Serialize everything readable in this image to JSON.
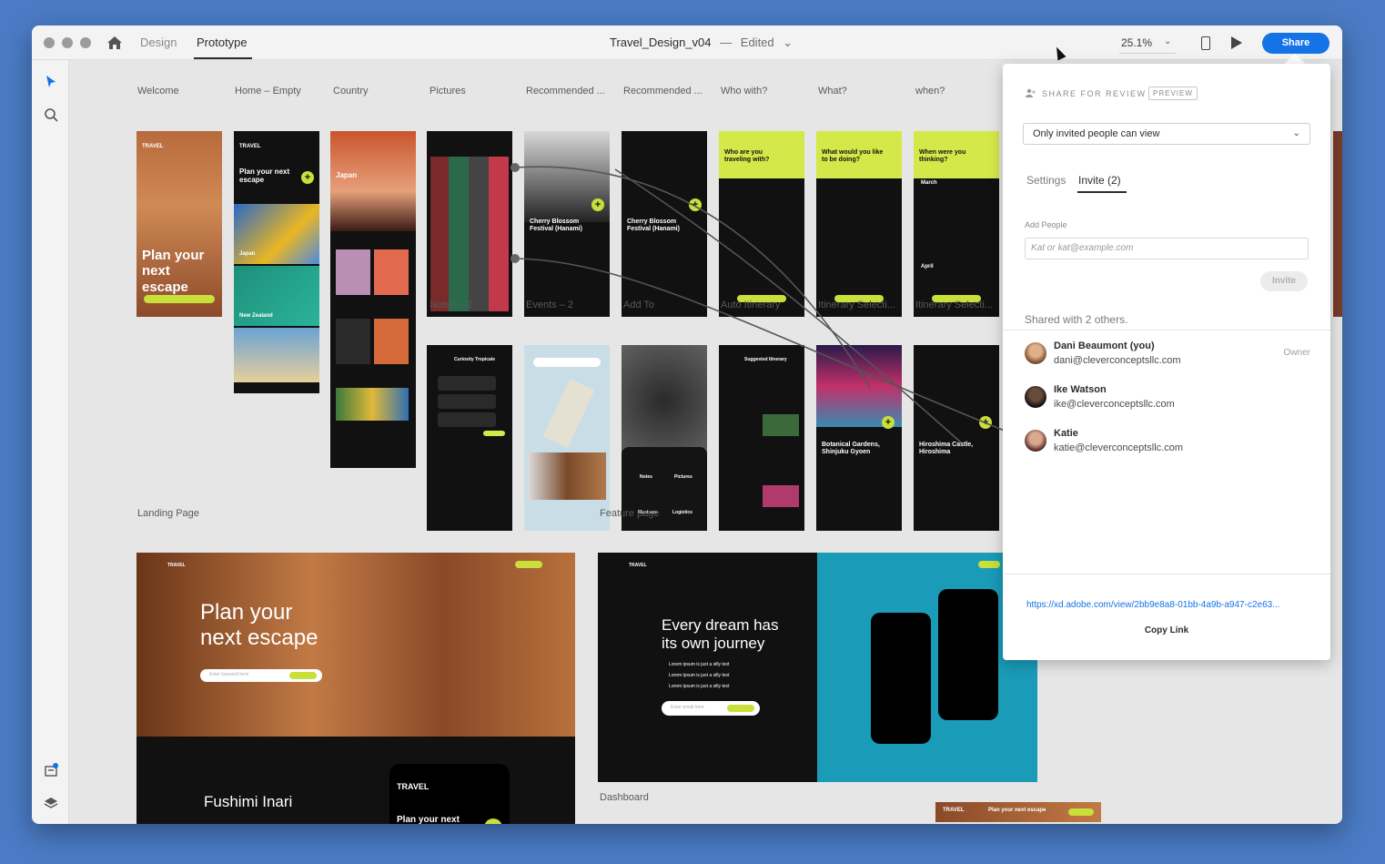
{
  "titlebar": {
    "mode_design": "Design",
    "mode_prototype": "Prototype",
    "document_name": "Travel_Design_v04",
    "separator": "—",
    "status": "Edited",
    "zoom": "25.1%",
    "share_label": "Share"
  },
  "artboards": {
    "row1": [
      "Welcome",
      "Home – Empty",
      "Country",
      "Pictures",
      "Recommended ...",
      "Recommended ...",
      "Who with?",
      "What?",
      "when?"
    ],
    "row2": [
      "Notes – 2",
      "Events – 2",
      "Add To",
      "Auto Itinerary",
      "Itinerary Selecti...",
      "Itinerary Selecti..."
    ],
    "landing": "Landing Page",
    "feature": "Feature page",
    "dashboard": "Dashboard"
  },
  "mockups": {
    "brand": "TRAVEL",
    "hero": "Plan your next escape",
    "home_title": "Plan your next escape",
    "country": "Japan",
    "japan_label": "Japan",
    "nz_label": "New Zealand",
    "events_title": "Cherry Blossom Festival (Hanami)",
    "who_title": "Who are you traveling with?",
    "what_title": "What would you like to be doing?",
    "when_title": "When were you thinking?",
    "when_month": "March",
    "when_month2": "April",
    "itin1": "Botanical Gardens, Shinjuku Gyoen",
    "itin2": "Hiroshima Castle, Hiroshima",
    "auto_title": "Suggested Itinerary",
    "notes_title": "Curiosity Tropicale",
    "add_notes": "Notes",
    "add_pictures": "Pictures",
    "add_mustsee": "Must see",
    "add_logistics": "Logistics",
    "landing_hero": "Plan your next escape",
    "landing_input": "Enter keyword here",
    "landing_section": "Fushimi Inari",
    "feature_hero": "Every dream has its own journey",
    "feature_bullets": [
      "Lorem ipsum is just a silly text",
      "Lorem ipsum is just a silly text",
      "Lorem ipsum is just a silly text"
    ],
    "feature_input": "Enter email here",
    "button": "Button"
  },
  "share_panel": {
    "heading": "SHARE FOR REVIEW",
    "badge": "PREVIEW",
    "access": "Only invited people can view",
    "tabs": [
      "Settings",
      "Invite (2)"
    ],
    "add_people_label": "Add People",
    "add_people_placeholder": "Kat or kat@example.com",
    "invite_label": "Invite",
    "shared_with": "Shared with 2 others.",
    "people": [
      {
        "name": "Dani Beaumont (you)",
        "email": "dani@cleverconceptsllc.com",
        "role": "Owner"
      },
      {
        "name": "Ike Watson",
        "email": "ike@cleverconceptsllc.com",
        "role": ""
      },
      {
        "name": "Katie",
        "email": "katie@cleverconceptsllc.com",
        "role": ""
      }
    ],
    "link": "https://xd.adobe.com/view/2bb9e8a8-01bb-4a9b-a947-c2e63...",
    "copy_link": "Copy Link"
  },
  "colors": {
    "accent": "#1473e6",
    "lime": "#c9df3a",
    "canvas": "#e6e6e6"
  }
}
